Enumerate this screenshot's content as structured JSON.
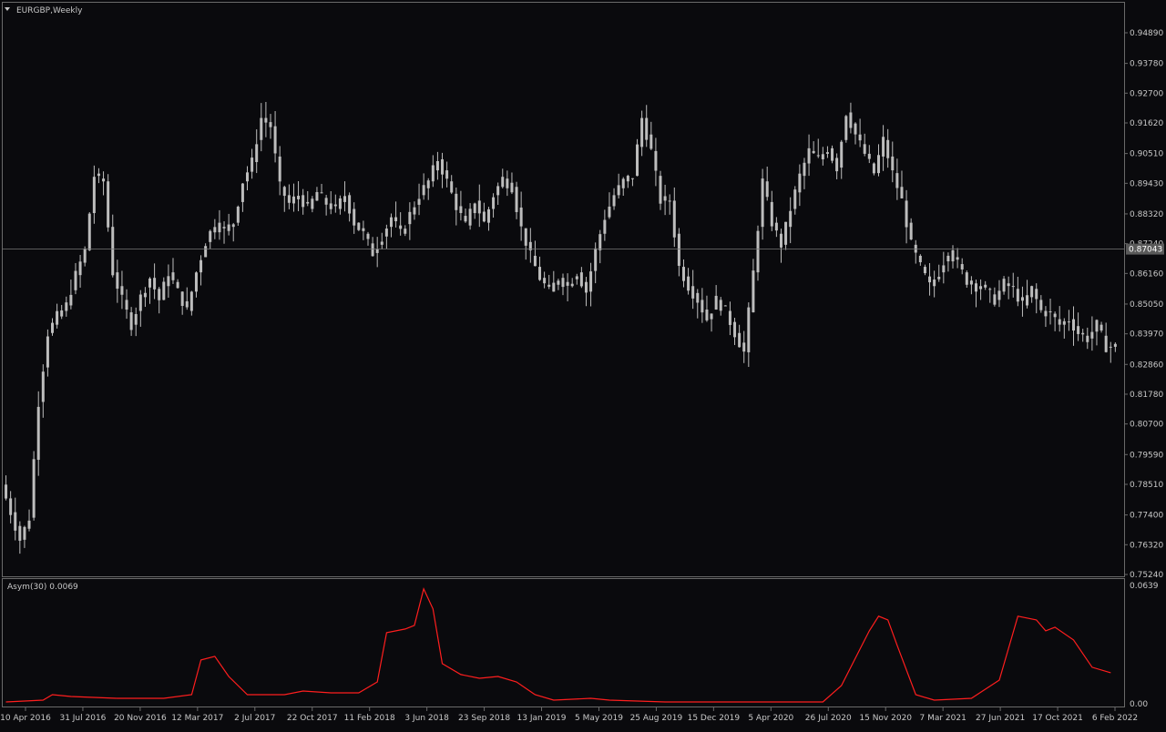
{
  "window": {
    "symbol_label": "EURGBP,Weekly"
  },
  "indicator": {
    "label": "Asym(30) 0.0069",
    "axis_top": "0.0639",
    "axis_bottom": "0.00"
  },
  "colors": {
    "background": "#0a0a0d",
    "candle": "#bdbdbd",
    "indicator_line": "#ff1e1e",
    "axis_text": "#c8c8c8",
    "current_price_bg": "#5a5a5a"
  },
  "chart_data": [
    {
      "type": "candlestick",
      "title": "EURGBP,Weekly",
      "ylim": [
        0.7524,
        0.9589
      ],
      "y_ticks": [
        "0.94890",
        "0.93780",
        "0.92700",
        "0.91620",
        "0.90510",
        "0.89430",
        "0.88320",
        "0.87240",
        "0.86160",
        "0.85050",
        "0.83970",
        "0.82860",
        "0.81780",
        "0.80700",
        "0.79590",
        "0.78510",
        "0.77400",
        "0.76320",
        "0.75240"
      ],
      "x_ticks": [
        "10 Apr 2016",
        "31 Jul 2016",
        "20 Nov 2016",
        "12 Mar 2017",
        "2 Jul 2017",
        "22 Oct 2017",
        "11 Feb 2018",
        "3 Jun 2018",
        "23 Sep 2018",
        "13 Jan 2019",
        "5 May 2019",
        "25 Aug 2019",
        "15 Dec 2019",
        "5 Apr 2020",
        "26 Jul 2020",
        "15 Nov 2020",
        "7 Mar 2021",
        "27 Jun 2021",
        "17 Oct 2021",
        "6 Feb 2022"
      ],
      "current_price": 0.87043,
      "current_price_label": "0.87043",
      "trend_points": [
        [
          0,
          0.785
        ],
        [
          2,
          0.775
        ],
        [
          4,
          0.765
        ],
        [
          6,
          0.773
        ],
        [
          8,
          0.815
        ],
        [
          10,
          0.84
        ],
        [
          12,
          0.846
        ],
        [
          14,
          0.85
        ],
        [
          16,
          0.861
        ],
        [
          18,
          0.87
        ],
        [
          20,
          0.897
        ],
        [
          22,
          0.895
        ],
        [
          24,
          0.862
        ],
        [
          26,
          0.852
        ],
        [
          28,
          0.843
        ],
        [
          30,
          0.853
        ],
        [
          32,
          0.86
        ],
        [
          34,
          0.852
        ],
        [
          36,
          0.862
        ],
        [
          38,
          0.855
        ],
        [
          40,
          0.848
        ],
        [
          42,
          0.862
        ],
        [
          44,
          0.873
        ],
        [
          46,
          0.88
        ],
        [
          48,
          0.877
        ],
        [
          50,
          0.88
        ],
        [
          52,
          0.895
        ],
        [
          54,
          0.902
        ],
        [
          56,
          0.918
        ],
        [
          58,
          0.915
        ],
        [
          60,
          0.893
        ],
        [
          62,
          0.887
        ],
        [
          64,
          0.89
        ],
        [
          66,
          0.885
        ],
        [
          68,
          0.891
        ],
        [
          70,
          0.887
        ],
        [
          72,
          0.885
        ],
        [
          74,
          0.89
        ],
        [
          76,
          0.88
        ],
        [
          78,
          0.876
        ],
        [
          80,
          0.869
        ],
        [
          82,
          0.875
        ],
        [
          84,
          0.882
        ],
        [
          86,
          0.876
        ],
        [
          88,
          0.883
        ],
        [
          90,
          0.89
        ],
        [
          92,
          0.895
        ],
        [
          94,
          0.903
        ],
        [
          96,
          0.895
        ],
        [
          98,
          0.886
        ],
        [
          100,
          0.879
        ],
        [
          102,
          0.888
        ],
        [
          104,
          0.88
        ],
        [
          106,
          0.89
        ],
        [
          108,
          0.896
        ],
        [
          110,
          0.893
        ],
        [
          112,
          0.878
        ],
        [
          114,
          0.868
        ],
        [
          116,
          0.86
        ],
        [
          118,
          0.855
        ],
        [
          120,
          0.86
        ],
        [
          122,
          0.857
        ],
        [
          124,
          0.862
        ],
        [
          126,
          0.855
        ],
        [
          128,
          0.87
        ],
        [
          130,
          0.882
        ],
        [
          132,
          0.89
        ],
        [
          134,
          0.895
        ],
        [
          136,
          0.897
        ],
        [
          138,
          0.918
        ],
        [
          140,
          0.906
        ],
        [
          142,
          0.888
        ],
        [
          144,
          0.888
        ],
        [
          146,
          0.864
        ],
        [
          148,
          0.857
        ],
        [
          150,
          0.852
        ],
        [
          152,
          0.845
        ],
        [
          154,
          0.852
        ],
        [
          156,
          0.848
        ],
        [
          158,
          0.84
        ],
        [
          160,
          0.833
        ],
        [
          162,
          0.862
        ],
        [
          164,
          0.895
        ],
        [
          166,
          0.88
        ],
        [
          168,
          0.872
        ],
        [
          170,
          0.885
        ],
        [
          172,
          0.897
        ],
        [
          174,
          0.906
        ],
        [
          176,
          0.903
        ],
        [
          178,
          0.907
        ],
        [
          180,
          0.9
        ],
        [
          182,
          0.92
        ],
        [
          184,
          0.912
        ],
        [
          186,
          0.905
        ],
        [
          188,
          0.898
        ],
        [
          190,
          0.91
        ],
        [
          192,
          0.898
        ],
        [
          194,
          0.888
        ],
        [
          196,
          0.872
        ],
        [
          198,
          0.864
        ],
        [
          200,
          0.857
        ],
        [
          202,
          0.862
        ],
        [
          204,
          0.87
        ],
        [
          206,
          0.865
        ],
        [
          208,
          0.859
        ],
        [
          210,
          0.857
        ],
        [
          212,
          0.856
        ],
        [
          214,
          0.852
        ],
        [
          216,
          0.858
        ],
        [
          218,
          0.856
        ],
        [
          220,
          0.85
        ],
        [
          222,
          0.856
        ],
        [
          224,
          0.848
        ],
        [
          226,
          0.847
        ],
        [
          228,
          0.843
        ],
        [
          230,
          0.845
        ],
        [
          232,
          0.84
        ],
        [
          234,
          0.838
        ],
        [
          236,
          0.843
        ],
        [
          238,
          0.835
        ],
        [
          240,
          0.835
        ]
      ],
      "indicator_points": [
        [
          0,
          0.001
        ],
        [
          8,
          0.002
        ],
        [
          10,
          0.005
        ],
        [
          14,
          0.004
        ],
        [
          24,
          0.003
        ],
        [
          34,
          0.003
        ],
        [
          40,
          0.005
        ],
        [
          42,
          0.024
        ],
        [
          45,
          0.026
        ],
        [
          48,
          0.015
        ],
        [
          52,
          0.005
        ],
        [
          60,
          0.005
        ],
        [
          64,
          0.007
        ],
        [
          70,
          0.006
        ],
        [
          76,
          0.006
        ],
        [
          80,
          0.012
        ],
        [
          82,
          0.039
        ],
        [
          86,
          0.041
        ],
        [
          88,
          0.043
        ],
        [
          90,
          0.063
        ],
        [
          92,
          0.052
        ],
        [
          94,
          0.022
        ],
        [
          98,
          0.016
        ],
        [
          102,
          0.014
        ],
        [
          106,
          0.015
        ],
        [
          110,
          0.012
        ],
        [
          114,
          0.005
        ],
        [
          118,
          0.002
        ],
        [
          126,
          0.003
        ],
        [
          130,
          0.002
        ],
        [
          142,
          0.001
        ],
        [
          176,
          0.001
        ],
        [
          180,
          0.01
        ],
        [
          184,
          0.03
        ],
        [
          186,
          0.04
        ],
        [
          188,
          0.048
        ],
        [
          190,
          0.046
        ],
        [
          192,
          0.032
        ],
        [
          196,
          0.005
        ],
        [
          200,
          0.002
        ],
        [
          208,
          0.003
        ],
        [
          214,
          0.013
        ],
        [
          218,
          0.048
        ],
        [
          222,
          0.046
        ],
        [
          224,
          0.04
        ],
        [
          226,
          0.042
        ],
        [
          230,
          0.035
        ],
        [
          234,
          0.02
        ],
        [
          238,
          0.017
        ]
      ]
    }
  ]
}
